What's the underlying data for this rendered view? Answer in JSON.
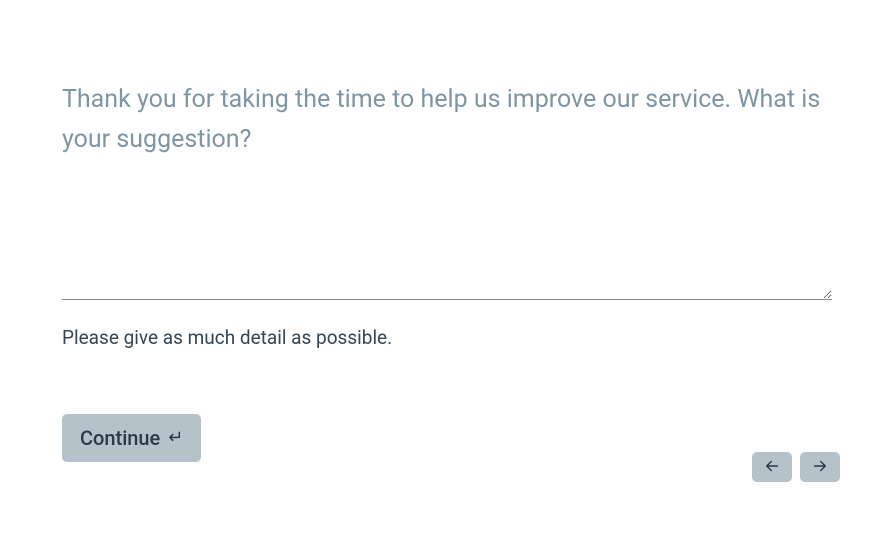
{
  "question": {
    "prompt": "Thank you for taking the time to help us improve our service. What is your suggestion?",
    "helper": "Please give as much detail as possible.",
    "input_value": ""
  },
  "actions": {
    "continue_label": "Continue"
  }
}
